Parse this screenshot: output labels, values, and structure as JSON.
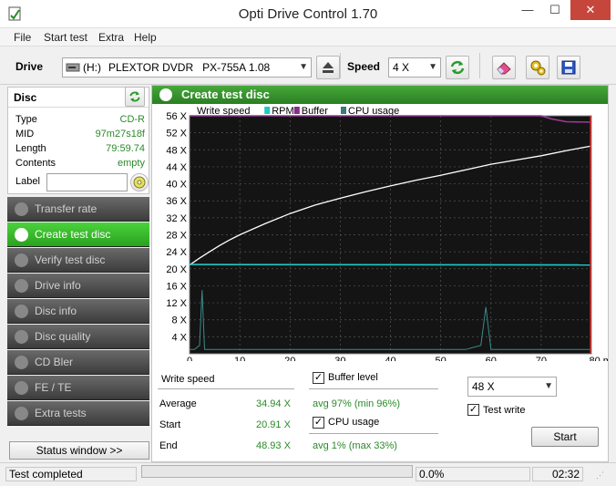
{
  "window": {
    "title": "Opti Drive Control 1.70",
    "min_glyph": "—",
    "max_glyph": "☐",
    "close_glyph": "✕"
  },
  "menu": [
    "File",
    "Start test",
    "Extra",
    "Help"
  ],
  "toolbar": {
    "drive_label": "Drive",
    "drive_letter": "(H:)",
    "drive_value": "PLEXTOR DVDR   PX-755A 1.08",
    "speed_label": "Speed",
    "speed_value": "4 X"
  },
  "disc": {
    "title": "Disc",
    "rows": [
      {
        "key": "Type",
        "value": "CD-R"
      },
      {
        "key": "MID",
        "value": "97m27s18f"
      },
      {
        "key": "Length",
        "value": "79:59.74"
      },
      {
        "key": "Contents",
        "value": "empty"
      }
    ],
    "label_key": "Label",
    "label_value": ""
  },
  "nav": [
    {
      "label": "Transfer rate",
      "active": false
    },
    {
      "label": "Create test disc",
      "active": true
    },
    {
      "label": "Verify test disc",
      "active": false
    },
    {
      "label": "Drive info",
      "active": false
    },
    {
      "label": "Disc info",
      "active": false
    },
    {
      "label": "Disc quality",
      "active": false
    },
    {
      "label": "CD Bler",
      "active": false
    },
    {
      "label": "FE / TE",
      "active": false
    },
    {
      "label": "Extra tests",
      "active": false
    }
  ],
  "status_window_label": "Status window >>",
  "main": {
    "title": "Create test disc"
  },
  "chart_data": {
    "type": "line",
    "legend": [
      "Write speed",
      "RPM",
      "Buffer",
      "CPU usage"
    ],
    "legend_colors": [
      "#ffffff",
      "#20c8c8",
      "#8a2a8a",
      "#3a7a7a"
    ],
    "x_ticks": [
      "0",
      "10",
      "20",
      "30",
      "40",
      "50",
      "60",
      "70",
      "80 min"
    ],
    "y_ticks": [
      "4 X",
      "8 X",
      "12 X",
      "16 X",
      "20 X",
      "24 X",
      "28 X",
      "32 X",
      "36 X",
      "40 X",
      "44 X",
      "48 X",
      "52 X",
      "56 X"
    ],
    "xlim": [
      0,
      80
    ],
    "ylim": [
      0,
      56
    ],
    "background": "#141414",
    "grid": true,
    "series": [
      {
        "name": "Write speed",
        "x": [
          0,
          2,
          4,
          6,
          8,
          10,
          15,
          20,
          25,
          30,
          35,
          40,
          45,
          50,
          55,
          60,
          65,
          70,
          75,
          80
        ],
        "values": [
          20.9,
          22.5,
          24,
          25.5,
          26.8,
          28,
          30.6,
          33,
          35,
          36.6,
          38.1,
          39.5,
          40.8,
          42,
          43.3,
          44.6,
          45.6,
          46.6,
          47.8,
          48.9
        ]
      },
      {
        "name": "RPM",
        "x": [
          0,
          80
        ],
        "values": [
          21,
          20.9
        ]
      },
      {
        "name": "Buffer",
        "x": [
          0,
          10,
          20,
          30,
          40,
          50,
          60,
          70,
          72,
          75,
          80
        ],
        "values": [
          56,
          56,
          56,
          56,
          56,
          56,
          56,
          56,
          55.3,
          54.6,
          54.5
        ]
      },
      {
        "name": "CPU usage",
        "x": [
          0,
          1,
          2,
          2.5,
          3,
          5,
          10,
          20,
          30,
          40,
          50,
          55,
          58,
          59,
          60,
          62,
          70,
          80
        ],
        "values": [
          1,
          1,
          2,
          15,
          1,
          1,
          1,
          1,
          1,
          1,
          1,
          1,
          2,
          11,
          1,
          1,
          1,
          1
        ]
      }
    ]
  },
  "stats": {
    "write_speed_label": "Write speed",
    "average_label": "Average",
    "average_value": "34.94 X",
    "start_label": "Start",
    "start_value": "20.91 X",
    "end_label": "End",
    "end_value": "48.93 X",
    "buffer_label": "Buffer level",
    "buffer_checked": true,
    "buffer_stat": "avg 97% (min 96%)",
    "cpu_label": "CPU usage",
    "cpu_checked": true,
    "cpu_stat": "avg 1% (max 33%)",
    "speed_select": "48 X",
    "test_write_label": "Test write",
    "test_write_checked": true,
    "start_button": "Start",
    "check_glyph": "✓"
  },
  "statusbar": {
    "status": "Test completed",
    "progress_fraction": 0,
    "percent": "0.0%",
    "time": "02:32"
  }
}
